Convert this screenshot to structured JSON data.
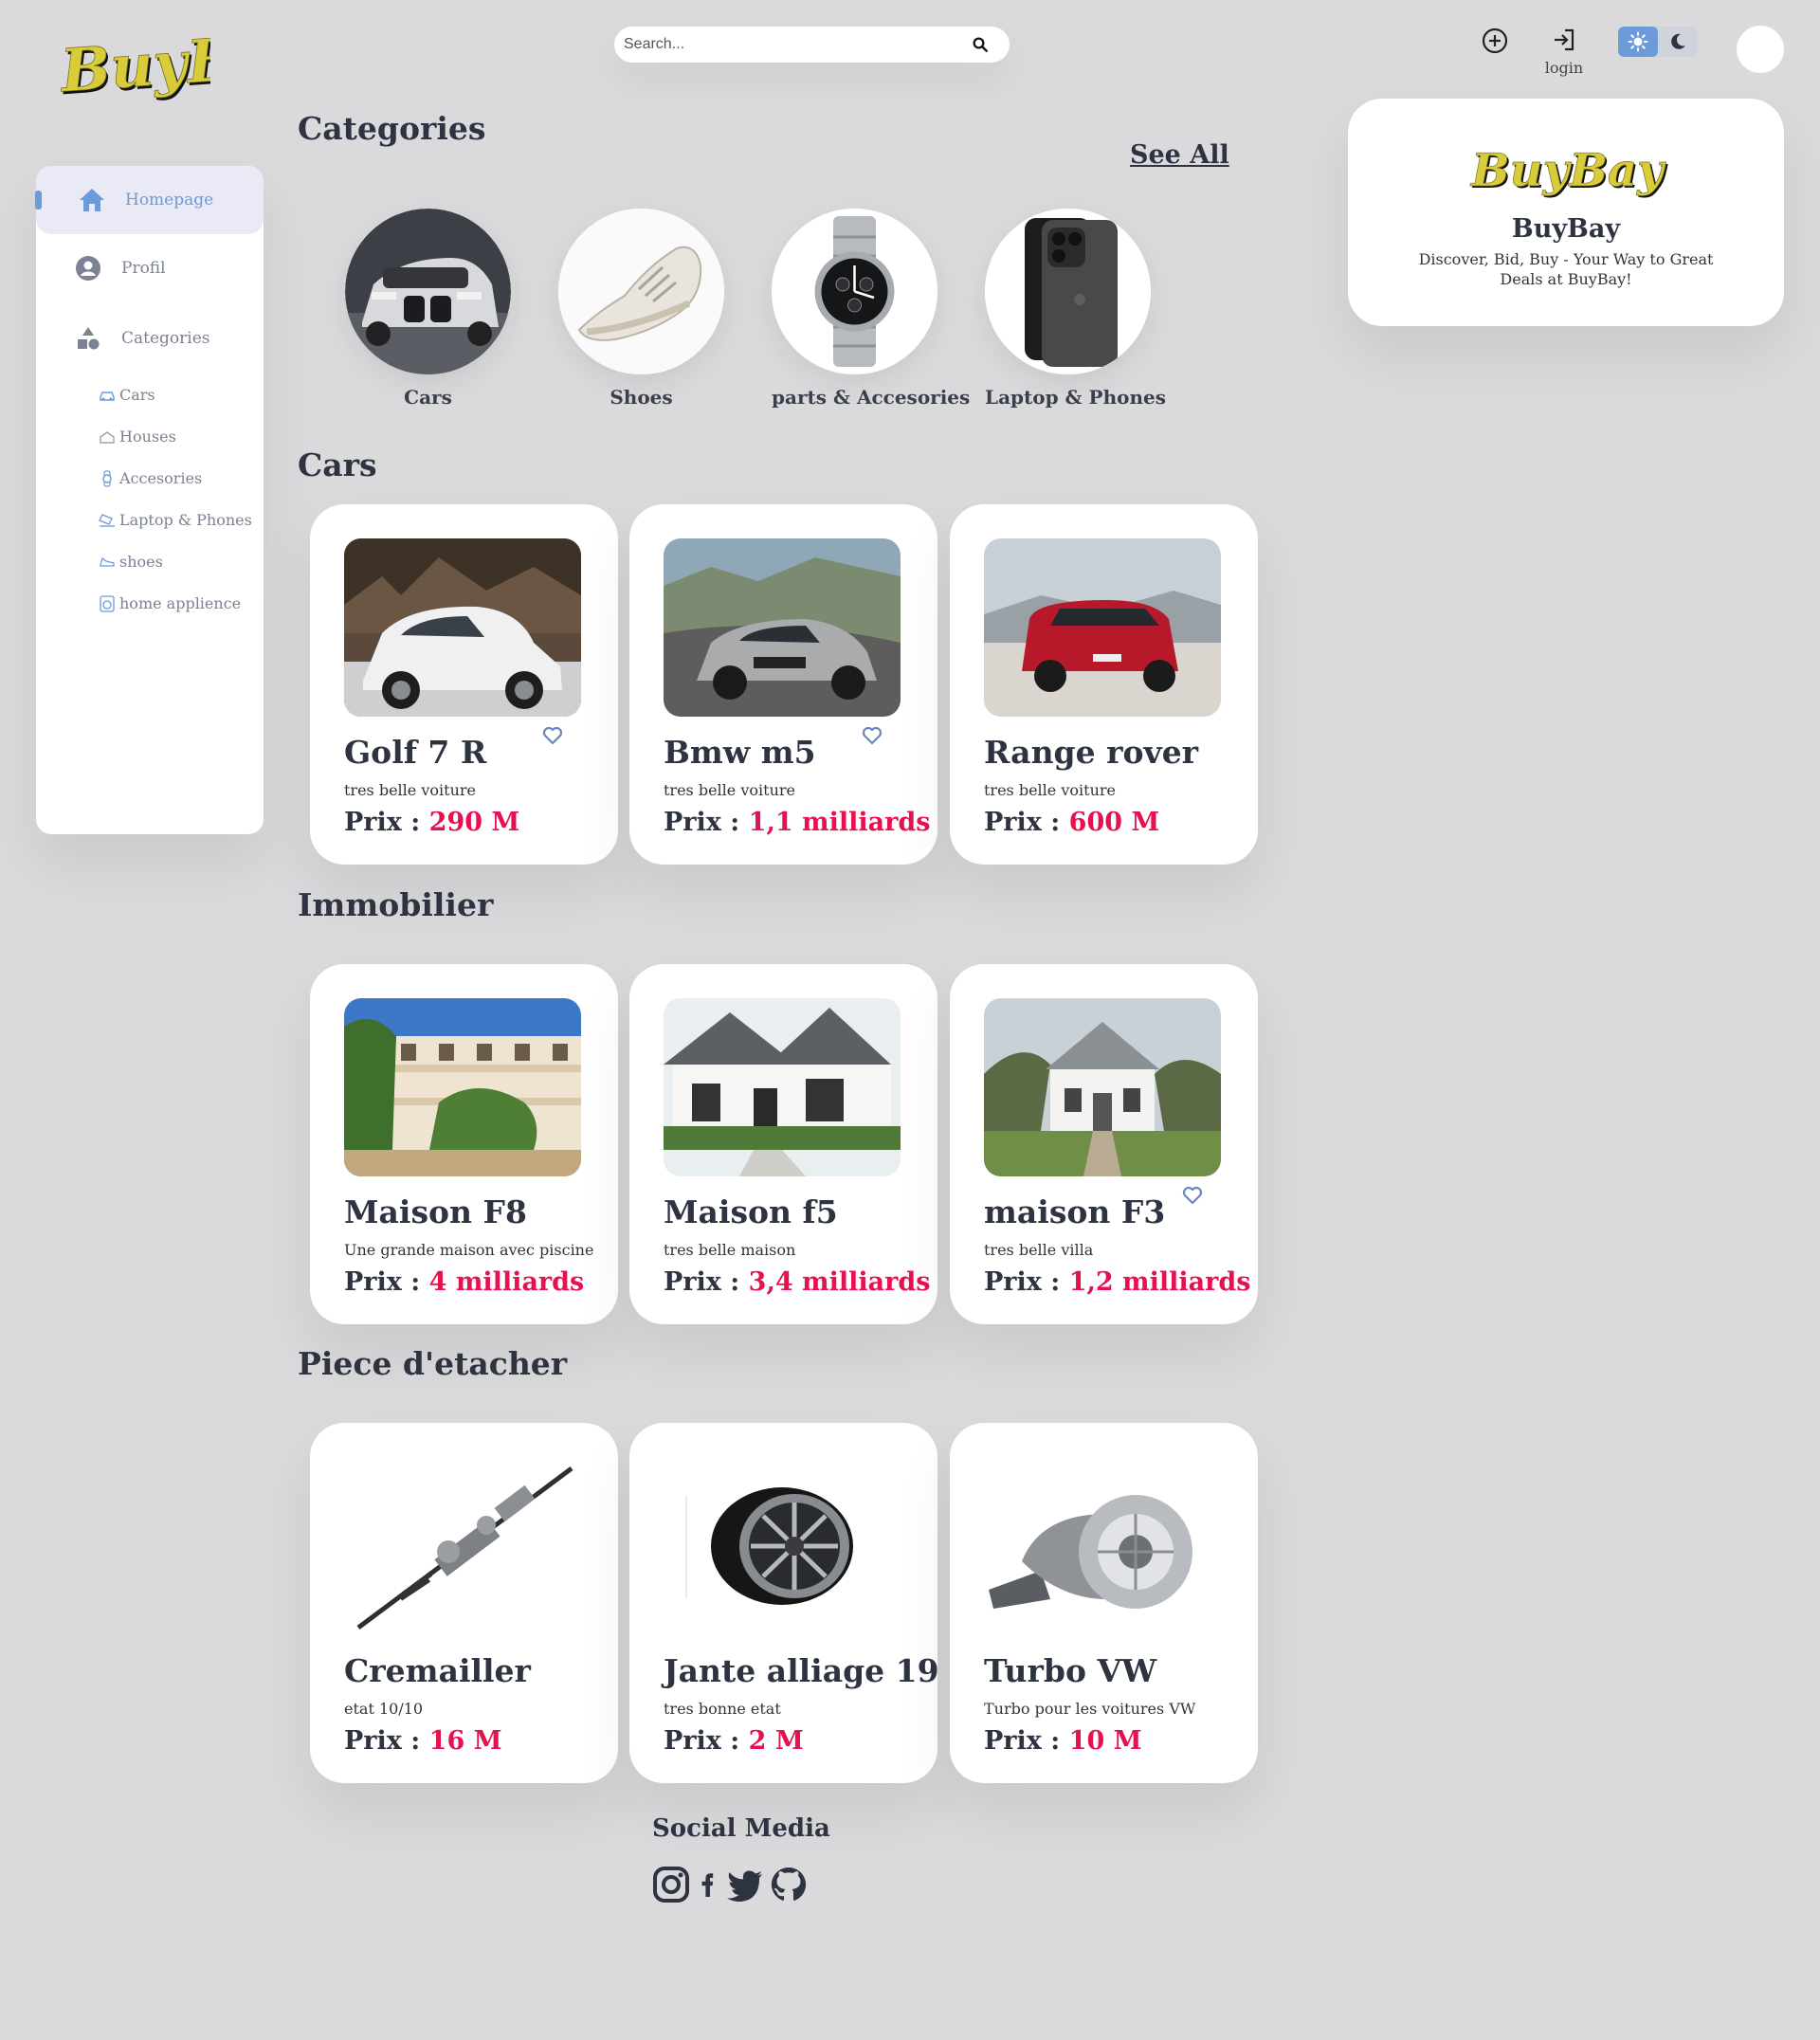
{
  "header": {
    "logo_text": "BuyBay",
    "search_placeholder": "Search...",
    "login_label": "login"
  },
  "brand_card": {
    "logo_text": "BuyBay",
    "name": "BuyBay",
    "tagline": "Discover, Bid, Buy - Your Way to Great Deals at BuyBay!"
  },
  "sidebar": {
    "items": [
      {
        "label": "Homepage",
        "icon": "home-icon",
        "active": true
      },
      {
        "label": "Profil",
        "icon": "user-circle-icon"
      },
      {
        "label": "Categories",
        "icon": "shapes-icon"
      }
    ],
    "sub_items": [
      {
        "label": "Cars",
        "icon": "car-icon"
      },
      {
        "label": "Houses",
        "icon": "house-icon"
      },
      {
        "label": "Accesories",
        "icon": "watch-icon"
      },
      {
        "label": "Laptop & Phones",
        "icon": "laptop-icon"
      },
      {
        "label": "shoes",
        "icon": "shoe-icon"
      },
      {
        "label": "home applience",
        "icon": "washer-icon"
      }
    ]
  },
  "categories": {
    "title": "Categories",
    "see_all": "See All",
    "items": [
      {
        "label": "Cars"
      },
      {
        "label": "Shoes"
      },
      {
        "label": "parts & Accesories"
      },
      {
        "label": "Laptop & Phones"
      }
    ]
  },
  "sections": [
    {
      "title": "Cars",
      "cards": [
        {
          "title": "Golf 7 R",
          "desc": "tres belle voiture",
          "price_label": "Prix : ",
          "price": "290 M",
          "favorite": true
        },
        {
          "title": "Bmw m5",
          "desc": "tres belle voiture",
          "price_label": "Prix : ",
          "price": "1,1 milliards",
          "favorite": true
        },
        {
          "title": "Range rover",
          "desc": "tres belle voiture",
          "price_label": "Prix : ",
          "price": "600 M",
          "favorite": false
        }
      ]
    },
    {
      "title": "Immobilier",
      "cards": [
        {
          "title": "Maison F8",
          "desc": "Une grande maison avec piscine",
          "price_label": "Prix : ",
          "price": "4 milliards",
          "favorite": false
        },
        {
          "title": "Maison f5",
          "desc": "tres belle maison",
          "price_label": "Prix : ",
          "price": "3,4 milliards",
          "favorite": false
        },
        {
          "title": "maison F3",
          "desc": "tres belle villa",
          "price_label": "Prix : ",
          "price": "1,2 milliards",
          "favorite": true
        }
      ]
    },
    {
      "title": "Piece d'etacher",
      "cards": [
        {
          "title": "Cremailler",
          "desc": "etat 10/10",
          "price_label": "Prix : ",
          "price": "16 M",
          "favorite": false
        },
        {
          "title": "Jante alliage 19",
          "desc": "tres bonne etat",
          "price_label": "Prix : ",
          "price": "2 M",
          "favorite": false
        },
        {
          "title": "Turbo VW",
          "desc": "Turbo pour les voitures VW",
          "price_label": "Prix : ",
          "price": "10 M",
          "favorite": false
        }
      ]
    }
  ],
  "footer": {
    "social_title": "Social Media",
    "icons": [
      "instagram-icon",
      "facebook-icon",
      "twitter-icon",
      "github-icon"
    ]
  },
  "colors": {
    "background": "#dadadc",
    "accent": "#6b9bd8",
    "price": "#e8114f",
    "text": "#2e3342",
    "logo_yellow": "#d9cc3a"
  }
}
